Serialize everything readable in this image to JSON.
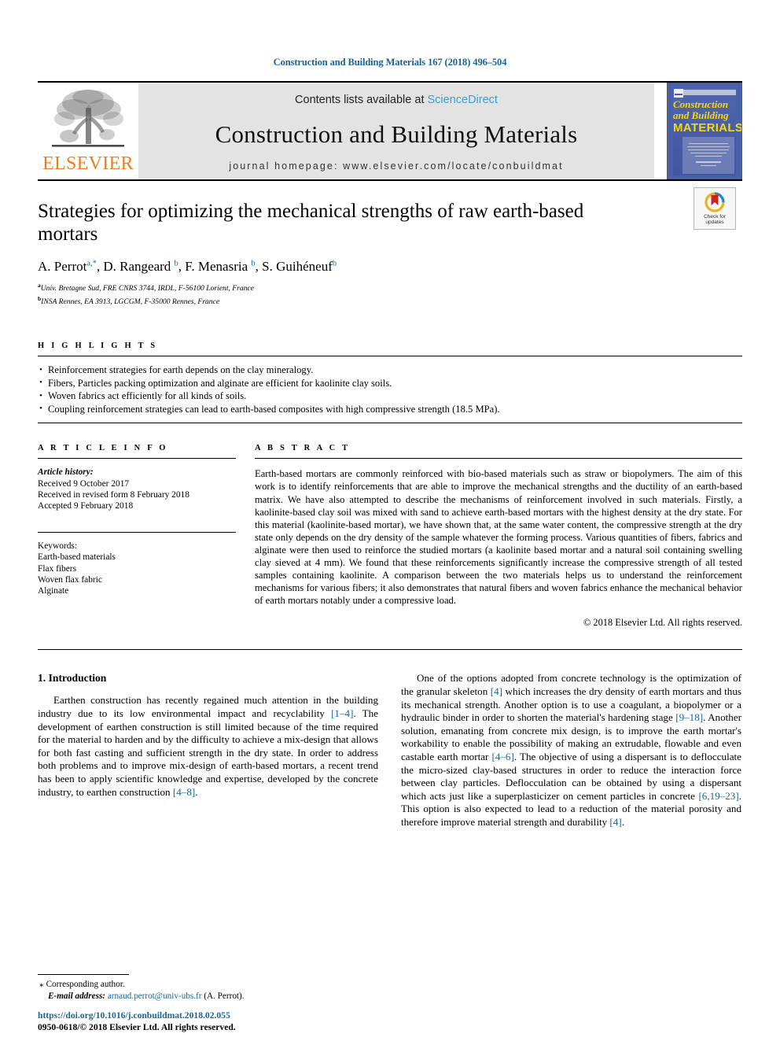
{
  "running_head": "Construction and Building Materials 167 (2018) 496–504",
  "masthead": {
    "publisher_logo_text": "ELSEVIER",
    "contents_prefix": "Contents lists available at",
    "contents_link": "ScienceDirect",
    "journal_name": "Construction and Building Materials",
    "homepage_line": "journal homepage: www.elsevier.com/locate/conbuildmat",
    "cover": {
      "title_line1": "Construction",
      "title_line2": "and Building",
      "title_line3": "MATERIALS",
      "subtitle": "An international journal dedicated to the investigation and innovative use of materials in construction and repair"
    }
  },
  "article": {
    "title": "Strategies for optimizing the mechanical strengths of raw earth-based mortars",
    "crossmark_label_line1": "Check for",
    "crossmark_label_line2": "updates",
    "authors": [
      {
        "name": "A. Perrot",
        "marks": "a,*"
      },
      {
        "name": "D. Rangeard",
        "marks": "b"
      },
      {
        "name": "F. Menasria",
        "marks": "b"
      },
      {
        "name": "S. Guihéneuf",
        "marks": "b"
      }
    ],
    "affiliations": [
      {
        "mark": "a",
        "text": "Univ. Bretagne Sud, FRE CNRS 3744, IRDL, F-56100 Lorient, France"
      },
      {
        "mark": "b",
        "text": "INSA Rennes, EA 3913, LGCGM, F-35000 Rennes, France"
      }
    ]
  },
  "highlights": {
    "heading": "H I G H L I G H T S",
    "items": [
      "Reinforcement strategies for earth depends on the clay mineralogy.",
      "Fibers, Particles packing optimization and alginate are efficient for kaolinite clay soils.",
      "Woven fabrics act efficiently for all kinds of soils.",
      "Coupling reinforcement strategies can lead to earth-based composites with high compressive strength (18.5 MPa)."
    ]
  },
  "article_info": {
    "heading": "A R T I C L E   I N F O",
    "history_label": "Article history:",
    "history": [
      "Received 9 October 2017",
      "Received in revised form 8 February 2018",
      "Accepted 9 February 2018"
    ],
    "keywords_label": "Keywords:",
    "keywords": [
      "Earth-based materials",
      "Flax fibers",
      "Woven flax fabric",
      "Alginate"
    ]
  },
  "abstract": {
    "heading": "A B S T R A C T",
    "text": "Earth-based mortars are commonly reinforced with bio-based materials such as straw or biopolymers. The aim of this work is to identify reinforcements that are able to improve the mechanical strengths and the ductility of an earth-based matrix. We have also attempted to describe the mechanisms of reinforcement involved in such materials. Firstly, a kaolinite-based clay soil was mixed with sand to achieve earth-based mortars with the highest density at the dry state. For this material (kaolinite-based mortar), we have shown that, at the same water content, the compressive strength at the dry state only depends on the dry density of the sample whatever the forming process. Various quantities of fibers, fabrics and alginate were then used to reinforce the studied mortars (a kaolinite based mortar and a natural soil containing swelling clay sieved at 4 mm). We found that these reinforcements significantly increase the compressive strength of all tested samples containing kaolinite. A comparison between the two materials helps us to understand the reinforcement mechanisms for various fibers; it also demonstrates that natural fibers and woven fabrics enhance the mechanical behavior of earth mortars notably under a compressive load.",
    "copyright": "© 2018 Elsevier Ltd. All rights reserved."
  },
  "introduction": {
    "section_title": "1. Introduction",
    "left_paragraph_part1": "Earthen construction has recently regained much attention in the building industry due to its low environmental impact and recyclability ",
    "left_ref1": "[1–4]",
    "left_paragraph_part2": ". The development of earthen construction is still limited because of the time required for the material to harden and by the difficulty to achieve a mix-design that allows for both fast casting and sufficient strength in the dry state. In order to address both problems and to improve mix-design of earth-based mortars, a recent trend has been to apply scientific knowledge and expertise, developed by the concrete industry, to earthen construction ",
    "left_ref2": "[4–8]",
    "left_paragraph_part3": ".",
    "right_part1": "One of the options adopted from concrete technology is the optimization of the granular skeleton ",
    "right_ref1": "[4]",
    "right_part2": " which increases the dry density of earth mortars and thus its mechanical strength. Another option is to use a coagulant, a biopolymer or a hydraulic binder in order to shorten the material's hardening stage ",
    "right_ref2": "[9–18]",
    "right_part3": ". Another solution, emanating from concrete mix design, is to improve the earth mortar's workability to enable the possibility of making an extrudable, flowable and even castable earth mortar ",
    "right_ref3": "[4–6]",
    "right_part4": ". The objective of using a dispersant is to defl­occulate the micro-sized clay-based structures in order to reduce the interaction force between clay particles. Deflocculation can be obtained by using a dispersant which acts just like a superplasticizer on cement particles in concrete ",
    "right_ref4": "[6,19–23]",
    "right_part5": ". This option is also expected to lead to a reduction of the material porosity and therefore improve material strength and durability ",
    "right_ref5": "[4]",
    "right_part6": "."
  },
  "footer": {
    "corresponding_star": "⁎",
    "corresponding_text": "Corresponding author.",
    "email_label": "E-mail address:",
    "email": "arnaud.perrot@univ-ubs.fr",
    "email_suffix": "(A. Perrot).",
    "doi": "https://doi.org/10.1016/j.conbuildmat.2018.02.055",
    "issn_line": "0950-0618/© 2018 Elsevier Ltd. All rights reserved."
  },
  "colors": {
    "link_blue": "#1a6496",
    "sciencedirect_blue": "#3a9fd1",
    "elsevier_orange": "#ef7e1b",
    "cover_blue": "#4a5ea8",
    "cover_yellow": "#f5d90a"
  }
}
